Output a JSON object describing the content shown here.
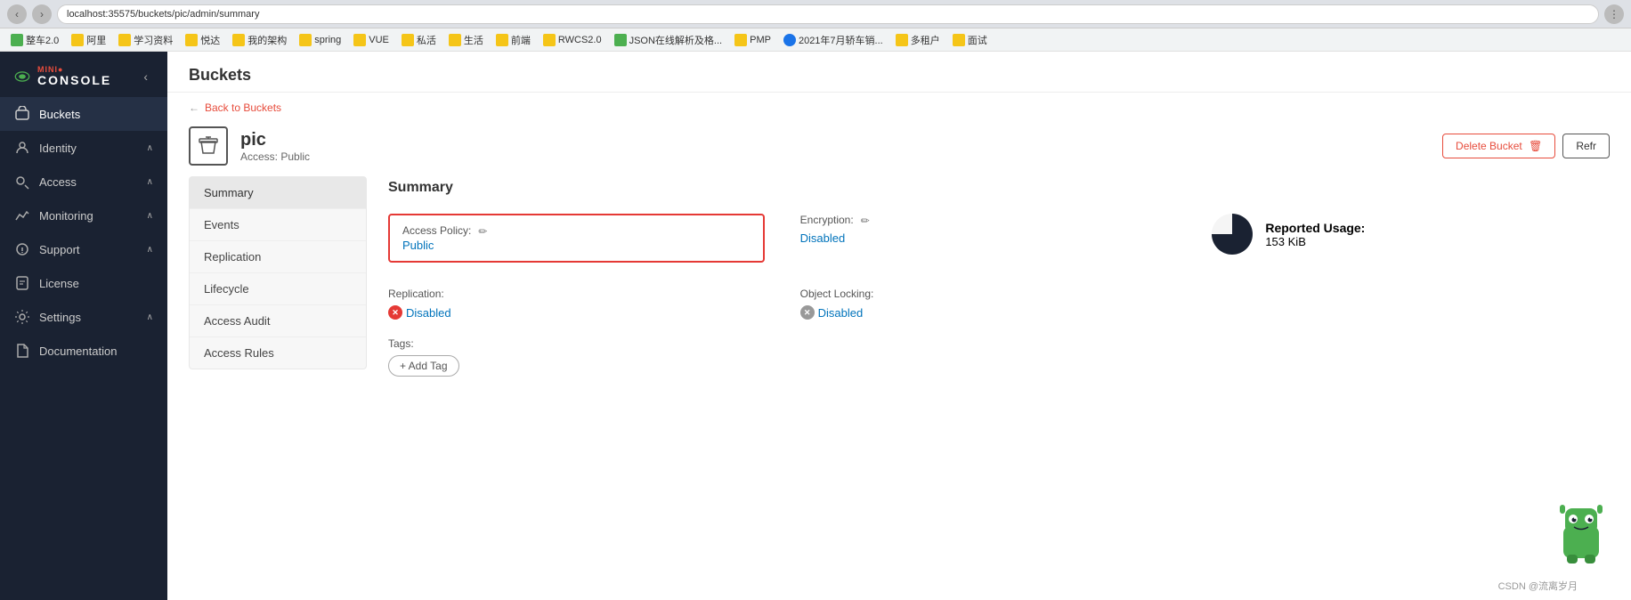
{
  "browser": {
    "url": "localhost:35575/buckets/pic/admin/summary",
    "bookmarks": [
      {
        "label": "整车2.0",
        "color": "green"
      },
      {
        "label": "阿里",
        "color": "yellow"
      },
      {
        "label": "学习资料",
        "color": "yellow"
      },
      {
        "label": "悦达",
        "color": "yellow"
      },
      {
        "label": "我的架构",
        "color": "yellow"
      },
      {
        "label": "spring",
        "color": "yellow"
      },
      {
        "label": "VUE",
        "color": "yellow"
      },
      {
        "label": "私活",
        "color": "yellow"
      },
      {
        "label": "生活",
        "color": "yellow"
      },
      {
        "label": "前端",
        "color": "yellow"
      },
      {
        "label": "RWCS2.0",
        "color": "yellow"
      },
      {
        "label": "JSON在线解析及格...",
        "color": "green"
      },
      {
        "label": "PMP",
        "color": "yellow"
      },
      {
        "label": "2021年7月轿车销...",
        "color": "yellow"
      },
      {
        "label": "多租户",
        "color": "yellow"
      },
      {
        "label": "面试",
        "color": "yellow"
      }
    ]
  },
  "sidebar": {
    "logo_mini": "MINI●",
    "logo_console": "CONSOLE",
    "items": [
      {
        "id": "buckets",
        "label": "Buckets",
        "active": true
      },
      {
        "id": "identity",
        "label": "Identity",
        "has_arrow": true
      },
      {
        "id": "access",
        "label": "Access",
        "has_arrow": true
      },
      {
        "id": "monitoring",
        "label": "Monitoring",
        "has_arrow": true
      },
      {
        "id": "support",
        "label": "Support",
        "has_arrow": true
      },
      {
        "id": "license",
        "label": "License"
      },
      {
        "id": "settings",
        "label": "Settings",
        "has_arrow": true
      },
      {
        "id": "documentation",
        "label": "Documentation"
      }
    ]
  },
  "page": {
    "title": "Buckets",
    "breadcrumb_back": "Back to Buckets",
    "bucket_name": "pic",
    "bucket_access_label": "Access:",
    "bucket_access_value": "Public",
    "delete_bucket_label": "Delete Bucket",
    "refresh_label": "Refr"
  },
  "left_nav": {
    "items": [
      {
        "id": "summary",
        "label": "Summary",
        "active": true
      },
      {
        "id": "events",
        "label": "Events"
      },
      {
        "id": "replication",
        "label": "Replication"
      },
      {
        "id": "lifecycle",
        "label": "Lifecycle"
      },
      {
        "id": "access_audit",
        "label": "Access Audit"
      },
      {
        "id": "access_rules",
        "label": "Access Rules"
      }
    ]
  },
  "summary_panel": {
    "title": "Summary",
    "access_policy_label": "Access Policy:",
    "access_policy_value": "Public",
    "replication_label": "Replication:",
    "replication_value": "Disabled",
    "tags_label": "Tags:",
    "add_tag_label": "+ Add Tag",
    "encryption_label": "Encryption:",
    "encryption_value": "Disabled",
    "object_locking_label": "Object Locking:",
    "object_locking_value": "Disabled",
    "reported_usage_title": "Reported Usage:",
    "reported_usage_size": "153 KiB"
  },
  "watermark": "CSDN @流离岁月"
}
